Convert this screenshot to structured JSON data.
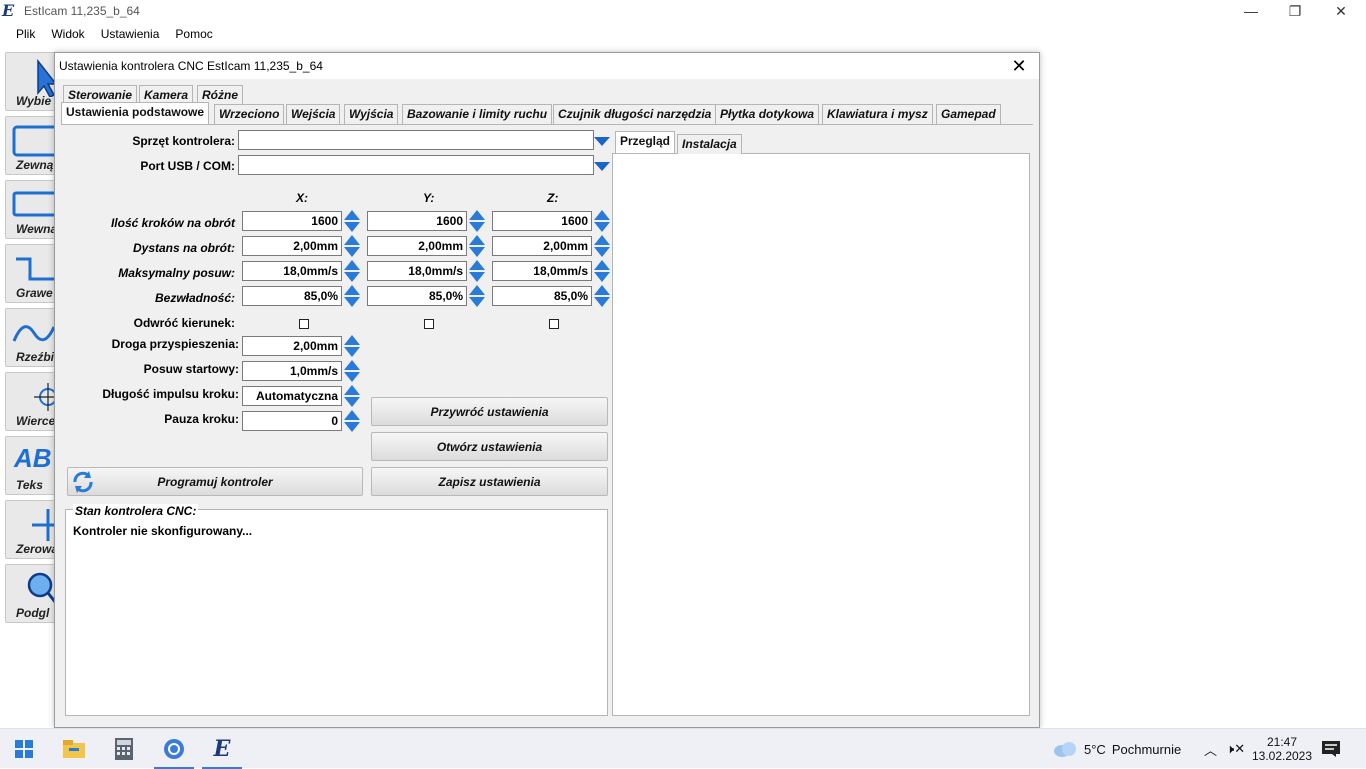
{
  "app": {
    "title": "EstIcam 11,235_b_64",
    "icon_letter": "E",
    "controls": {
      "minimize": "—",
      "restore": "❐",
      "close": "✕"
    }
  },
  "menu": [
    "Plik",
    "Widok",
    "Ustawienia",
    "Pomoc"
  ],
  "tools": [
    {
      "label": "Wybie",
      "icon": "cursor-arrow-icon"
    },
    {
      "label": "Zewną",
      "icon": "outer-contour-icon"
    },
    {
      "label": "Wewna",
      "icon": "inner-contour-icon"
    },
    {
      "label": "Grawe",
      "icon": "engrave-icon"
    },
    {
      "label": "Rzeźbie",
      "icon": "carve-icon"
    },
    {
      "label": "Wiercer",
      "icon": "drill-icon"
    },
    {
      "label": "Teks",
      "icon": "text-icon",
      "glyph": "AB"
    },
    {
      "label": "Zerowa",
      "icon": "zero-point-icon"
    },
    {
      "label": "Podgl",
      "icon": "preview-magnifier-icon"
    }
  ],
  "dialog": {
    "title": "Ustawienia kontrolera CNC EstIcam 11,235_b_64",
    "close": "✕",
    "tabs_row1": [
      "Sterowanie",
      "Kamera",
      "Różne"
    ],
    "tabs_row2": [
      "Ustawienia podstawowe",
      "Wrzeciono",
      "Wejścia",
      "Wyjścia",
      "Bazowanie i limity ruchu",
      "Czujnik długości narzędzia",
      "Płytka dotykowa",
      "Klawiatura i mysz",
      "Gamepad"
    ],
    "right_tabs": [
      "Przegląd",
      "Instalacja"
    ],
    "hardware_label": "Sprzęt kontrolera:",
    "hardware_value": "",
    "port_label": "Port USB / COM:",
    "port_value": "",
    "axes": [
      "X:",
      "Y:",
      "Z:"
    ],
    "axis_rows": [
      {
        "label": "Ilość kroków na obrót",
        "values": [
          "1600",
          "1600",
          "1600"
        ]
      },
      {
        "label": "Dystans na obrót:",
        "values": [
          "2,00mm",
          "2,00mm",
          "2,00mm"
        ]
      },
      {
        "label": "Maksymalny posuw:",
        "values": [
          "18,0mm/s",
          "18,0mm/s",
          "18,0mm/s"
        ]
      },
      {
        "label": "Bezwładność:",
        "values": [
          "85,0%",
          "85,0%",
          "85,0%"
        ]
      }
    ],
    "reverse_label": "Odwróć kierunek:",
    "reverse_checked": [
      false,
      false,
      false
    ],
    "single_rows": [
      {
        "label": "Droga przyspieszenia:",
        "value": "2,00mm"
      },
      {
        "label": "Posuw startowy:",
        "value": "1,0mm/s"
      },
      {
        "label": "Długość impulsu kroku:",
        "value": "Automatyczna"
      },
      {
        "label": "Pauza kroku:",
        "value": "0"
      }
    ],
    "buttons": {
      "restore": "Przywróć ustawienia",
      "open": "Otwórz ustawienia",
      "save": "Zapisz ustawienia",
      "program": "Programuj kontroler"
    },
    "status_title": "Stan kontrolera CNC:",
    "status_text": "Kontroler nie skonfigurowany..."
  },
  "taskbar": {
    "weather_temp": "5°C",
    "weather_desc": "Pochmurnie",
    "time": "21:47",
    "date": "13.02.2023"
  },
  "colors": {
    "accent": "#2a7ad8",
    "panel": "#f0f0f0",
    "taskbar": "#eef0f5"
  }
}
